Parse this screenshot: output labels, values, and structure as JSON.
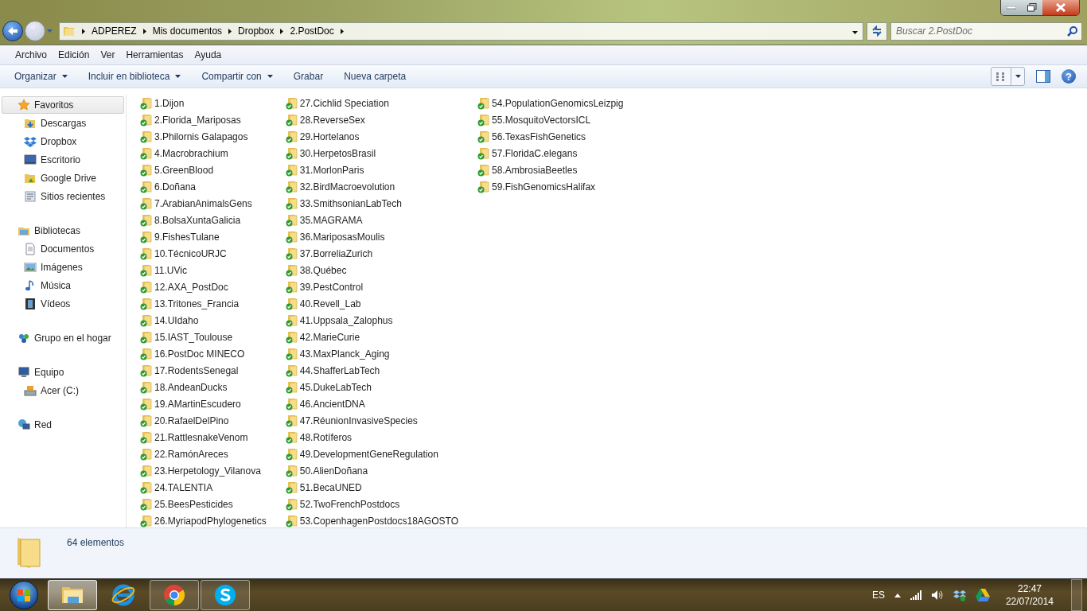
{
  "address_bar": {
    "breadcrumbs": [
      "ADPEREZ",
      "Mis documentos",
      "Dropbox",
      "2.PostDoc"
    ]
  },
  "search": {
    "placeholder": "Buscar 2.PostDoc"
  },
  "menu_bar": [
    "Archivo",
    "Edición",
    "Ver",
    "Herramientas",
    "Ayuda"
  ],
  "command_bar": [
    {
      "label": "Organizar",
      "dropdown": true
    },
    {
      "label": "Incluir en biblioteca",
      "dropdown": true
    },
    {
      "label": "Compartir con",
      "dropdown": true
    },
    {
      "label": "Grabar",
      "dropdown": false
    },
    {
      "label": "Nueva carpeta",
      "dropdown": false
    }
  ],
  "navigation": [
    {
      "label": "Favoritos",
      "selected": true,
      "children": [
        {
          "label": "Descargas",
          "selected": false
        },
        {
          "label": "Dropbox",
          "selected": false
        },
        {
          "label": "Escritorio",
          "selected": false
        },
        {
          "label": "Google Drive",
          "selected": false
        },
        {
          "label": "Sitios recientes",
          "selected": false
        }
      ]
    },
    {
      "label": "Bibliotecas",
      "selected": false,
      "children": [
        {
          "label": "Documentos",
          "selected": false
        },
        {
          "label": "Imágenes",
          "selected": false
        },
        {
          "label": "Música",
          "selected": false
        },
        {
          "label": "Vídeos",
          "selected": false
        }
      ]
    },
    {
      "label": "Grupo en el hogar",
      "selected": false
    },
    {
      "label": "Equipo",
      "selected": false,
      "children": [
        {
          "label": "Acer (C:)",
          "selected": false
        }
      ]
    },
    {
      "label": "Red",
      "selected": false
    }
  ],
  "files": [
    "1.Dijon",
    "2.Florida_Mariposas",
    "3.Philornis Galapagos",
    "4.Macrobrachium",
    "5.GreenBlood",
    "6.Doñana",
    "7.ArabianAnimalsGens",
    "8.BolsaXuntaGalicia",
    "9.FishesTulane",
    "10.TécnicoURJC",
    "11.UVic",
    "12.AXA_PostDoc",
    "13.Tritones_Francia",
    "14.UIdaho",
    "15.IAST_Toulouse",
    "16.PostDoc MINECO",
    "17.RodentsSenegal",
    "18.AndeanDucks",
    "19.AMartinEscudero",
    "20.RafaelDelPino",
    "21.RattlesnakeVenom",
    "22.RamónAreces",
    "23.Herpetology_Vilanova",
    "24.TALENTIA",
    "25.BeesPesticides",
    "26.MyriapodPhylogenetics",
    "27.Cichlid Speciation",
    "28.ReverseSex",
    "29.Hortelanos",
    "30.HerpetosBrasil",
    "31.MorlonParis",
    "32.BirdMacroevolution",
    "33.SmithsonianLabTech",
    "35.MAGRAMA",
    "36.MariposasMoulis",
    "37.BorreliaZurich",
    "38.Québec",
    "39.PestControl",
    "40.Revell_Lab",
    "41.Uppsala_Zalophus",
    "42.MarieCurie",
    "43.MaxPlanck_Aging",
    "44.ShafferLabTech",
    "45.DukeLabTech",
    "46.AncientDNA",
    "47.RéunionInvasiveSpecies",
    "48.Rotíferos",
    "49.DevelopmentGeneRegulation",
    "50.AlienDoñana",
    "51.BecaUNED",
    "52.TwoFrenchPostdocs",
    "53.CopenhagenPostdocs18AGOSTO",
    "54.PopulationGenomicsLeizpig",
    "55.MosquitoVectorsICL",
    "56.TexasFishGenetics",
    "57.FloridaC.elegans",
    "58.AmbrosiaBeetles",
    "59.FishGenomicsHalifax"
  ],
  "help_button": {
    "label": "?"
  },
  "details_pane": {
    "summary": "64 elementos"
  },
  "taskbar": {
    "apps": [
      {
        "selected": true,
        "running": true
      },
      {
        "selected": false,
        "running": false
      },
      {
        "selected": false,
        "running": true
      },
      {
        "selected": false,
        "running": true
      }
    ],
    "language": "ES",
    "clock_time": "22:47",
    "clock_date": "22/07/2014"
  }
}
